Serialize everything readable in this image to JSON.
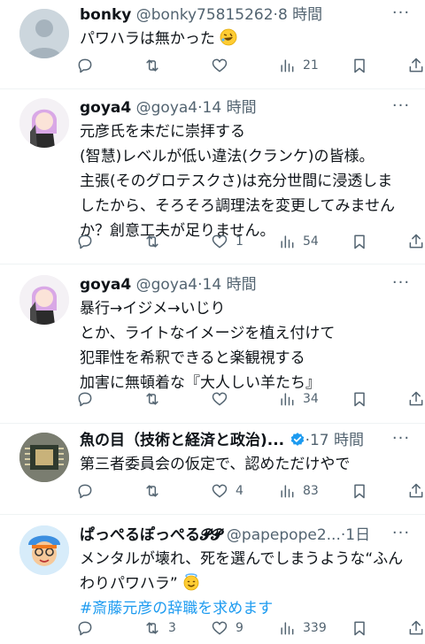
{
  "tweets": [
    {
      "name": "bonky",
      "handle": "@bonky75815262",
      "dot": "·",
      "time": "8 時間",
      "lines": [
        "パワハラは無かった"
      ],
      "emoji": "rolling-on-floor-laughing",
      "counts": {
        "reply": "",
        "retweet": "",
        "like": "",
        "views": "21"
      }
    },
    {
      "name": "goya4",
      "handle": "@goya4",
      "dot": "·",
      "time": "14 時間",
      "lines": [
        "元彦氏を未だに崇拝する",
        "(智慧)レベルが低い違法(クランケ)の皆様。",
        "主張(そのグロテスクさ)は充分世間に浸透しま",
        "したから、そろそろ調理法を変更してみません",
        "か？創意工夫が足りません。"
      ],
      "counts": {
        "reply": "",
        "retweet": "",
        "like": "1",
        "views": "54"
      }
    },
    {
      "name": "goya4",
      "handle": "@goya4",
      "dot": "·",
      "time": "14 時間",
      "lines": [
        "暴行→イジメ→いじり",
        "とか、ライトなイメージを植え付けて",
        "犯罪性を希釈できると楽観視する",
        "加害に無頓着な『大人しい羊たち』"
      ],
      "counts": {
        "reply": "",
        "retweet": "",
        "like": "",
        "views": "34"
      }
    },
    {
      "name": "魚の目（技術と経済と政治)...",
      "handle": "",
      "dot": "·",
      "time": "17 時間",
      "verified": true,
      "lines": [
        "第三者委員会の仮定で、認めただけやで"
      ],
      "counts": {
        "reply": "",
        "retweet": "",
        "like": "4",
        "views": "83"
      }
    },
    {
      "name": "ぱっぺるぽっぺる𝓟𝓟",
      "handle": "@papepope2...",
      "dot": "·",
      "time": "1日",
      "lines": [
        "メンタルが壊れ、死を選んでしまうような“ふん",
        "わりパワハラ”"
      ],
      "emoji": "smiling-face-with-halo",
      "hashtag": "#斎藤元彦の辞職を求めます",
      "counts": {
        "reply": "",
        "retweet": "3",
        "like": "9",
        "views": "339"
      }
    }
  ],
  "colors": {
    "text": "#0f1419",
    "muted": "#536471",
    "link": "#1d9bf0",
    "divider": "#eff3f4"
  }
}
